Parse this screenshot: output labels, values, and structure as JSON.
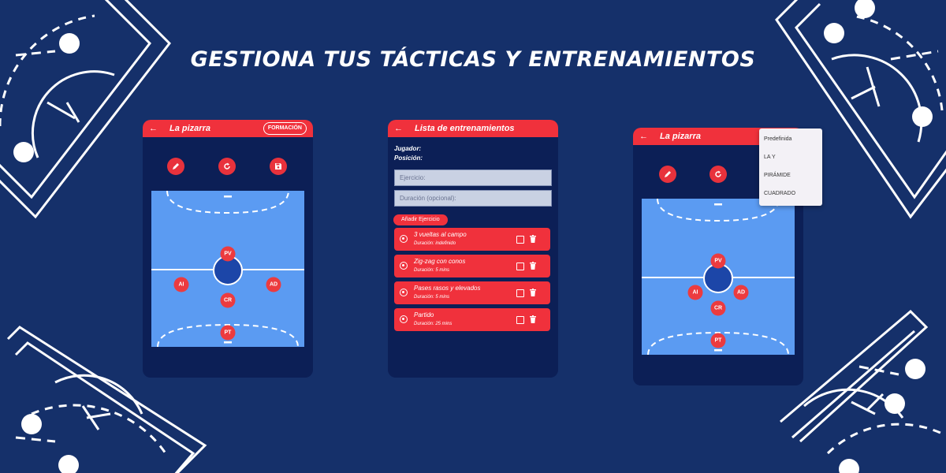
{
  "headline": "GESTIONA TUS TÁCTICAS Y ENTRENAMIENTOS",
  "colors": {
    "background": "#15306a",
    "phone": "#0c1f56",
    "accent": "#f0313c",
    "court": "#5b9bf2",
    "goal_area": "#1c46a8"
  },
  "screen1": {
    "title": "La pizarra",
    "back_icon": "arrow-left-icon",
    "formation_button": "FORMACIÓN",
    "toolbar": [
      {
        "icon": "pencil-icon"
      },
      {
        "icon": "refresh-icon"
      },
      {
        "icon": "save-icon"
      }
    ],
    "players": [
      "PV",
      "AI",
      "AD",
      "CR",
      "PT"
    ]
  },
  "screen2": {
    "title": "Lista de entrenamientos",
    "back_icon": "arrow-left-icon",
    "player_label": "Jugador:",
    "position_label": "Posición:",
    "exercise_placeholder": "Ejercicio:",
    "duration_placeholder": "Duración (opcional):",
    "add_button": "Añadir Ejercicio",
    "exercises": [
      {
        "name": "3 vueltas al campo",
        "duration": "Duración: indefinido"
      },
      {
        "name": "Zig-zag con conos",
        "duration": "Duración: 5 mins"
      },
      {
        "name": "Pases rasos y elevados",
        "duration": "Duración: 5 mins"
      },
      {
        "name": "Partido",
        "duration": "Duración: 25 mins"
      }
    ]
  },
  "screen3": {
    "title": "La pizarra",
    "back_icon": "arrow-left-icon",
    "menu": [
      "Predefinida",
      "LA Y",
      "PIRÁMIDE",
      "CUADRADO"
    ],
    "players": [
      "PV",
      "AI",
      "AD",
      "CR",
      "PT"
    ]
  }
}
